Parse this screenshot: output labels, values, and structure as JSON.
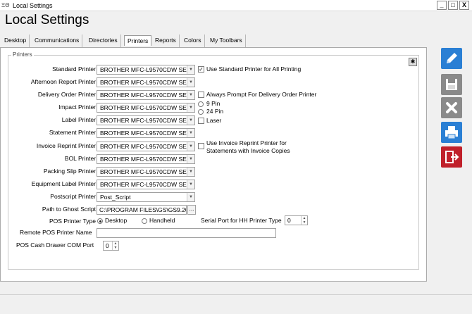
{
  "window": {
    "icon_text": "ΞΘ",
    "title": "Local Settings",
    "minimize": "_",
    "maximize": "□",
    "close": "X"
  },
  "app_title": "Local Settings",
  "tabs": [
    "Desktop",
    "Communications",
    "Directories",
    "Printers",
    "Reports",
    "Colors",
    "My Toolbars"
  ],
  "active_tab": "Printers",
  "group_title": "Printers",
  "printers": [
    {
      "label": "Standard Printer",
      "value": "BROTHER MFC-L9570CDW SE"
    },
    {
      "label": "Afternoon Report Printer",
      "value": "BROTHER MFC-L9570CDW SE"
    },
    {
      "label": "Delivery Order Printer",
      "value": "BROTHER MFC-L9570CDW SE"
    },
    {
      "label": "Impact Printer",
      "value": "BROTHER MFC-L9570CDW SE"
    },
    {
      "label": "Label Printer",
      "value": "BROTHER MFC-L9570CDW SE"
    },
    {
      "label": "Statement Printer",
      "value": "BROTHER MFC-L9570CDW SE"
    },
    {
      "label": "Invoice Reprint Printer",
      "value": "BROTHER MFC-L9570CDW SE"
    },
    {
      "label": "BOL Printer",
      "value": "BROTHER MFC-L9570CDW SE"
    },
    {
      "label": "Packing Slip Printer",
      "value": "BROTHER MFC-L9570CDW SE"
    },
    {
      "label": "Equipment Label Printer",
      "value": "BROTHER MFC-L9570CDW SE"
    },
    {
      "label": "Postscript Printer",
      "value": "Post_Script"
    }
  ],
  "ghost_script": {
    "label": "Path to Ghost Script",
    "value": "C:\\PROGRAM FILES\\GS\\GS9.20",
    "button": "..."
  },
  "options": {
    "use_standard": {
      "label": "Use Standard Printer for All Printing",
      "checked": true
    },
    "always_prompt": {
      "label": "Always Prompt For Delivery Order Printer",
      "checked": false
    },
    "pin9": {
      "label": "9 Pin",
      "selected": false
    },
    "pin24": {
      "label": "24 Pin",
      "selected": false
    },
    "laser": {
      "label": "Laser",
      "checked": false
    },
    "invoice_reprint_line1": "Use Invoice Reprint Printer for",
    "invoice_reprint_line2": "Statements with Invoice Copies"
  },
  "pos": {
    "type_label": "POS Printer Type",
    "desktop": "Desktop",
    "handheld": "Handheld",
    "selected": "Desktop",
    "serial_port_label": "Serial Port for HH Printer Type",
    "serial_port_value": "0",
    "remote_label": "Remote POS Printer Name",
    "remote_value": "",
    "cash_drawer_label": "POS Cash Drawer COM Port",
    "cash_drawer_value": "0"
  },
  "side_buttons": [
    {
      "name": "edit-button",
      "icon": "pencil-icon",
      "color": "#2a7fd4"
    },
    {
      "name": "save-button",
      "icon": "floppy-icon",
      "color": "#8a8a8a"
    },
    {
      "name": "cancel-button",
      "icon": "x-icon",
      "color": "#8a8a8a"
    },
    {
      "name": "print-button",
      "icon": "printer-icon",
      "color": "#2a7fd4"
    },
    {
      "name": "exit-button",
      "icon": "exit-door-icon",
      "color": "#c0202a"
    }
  ]
}
